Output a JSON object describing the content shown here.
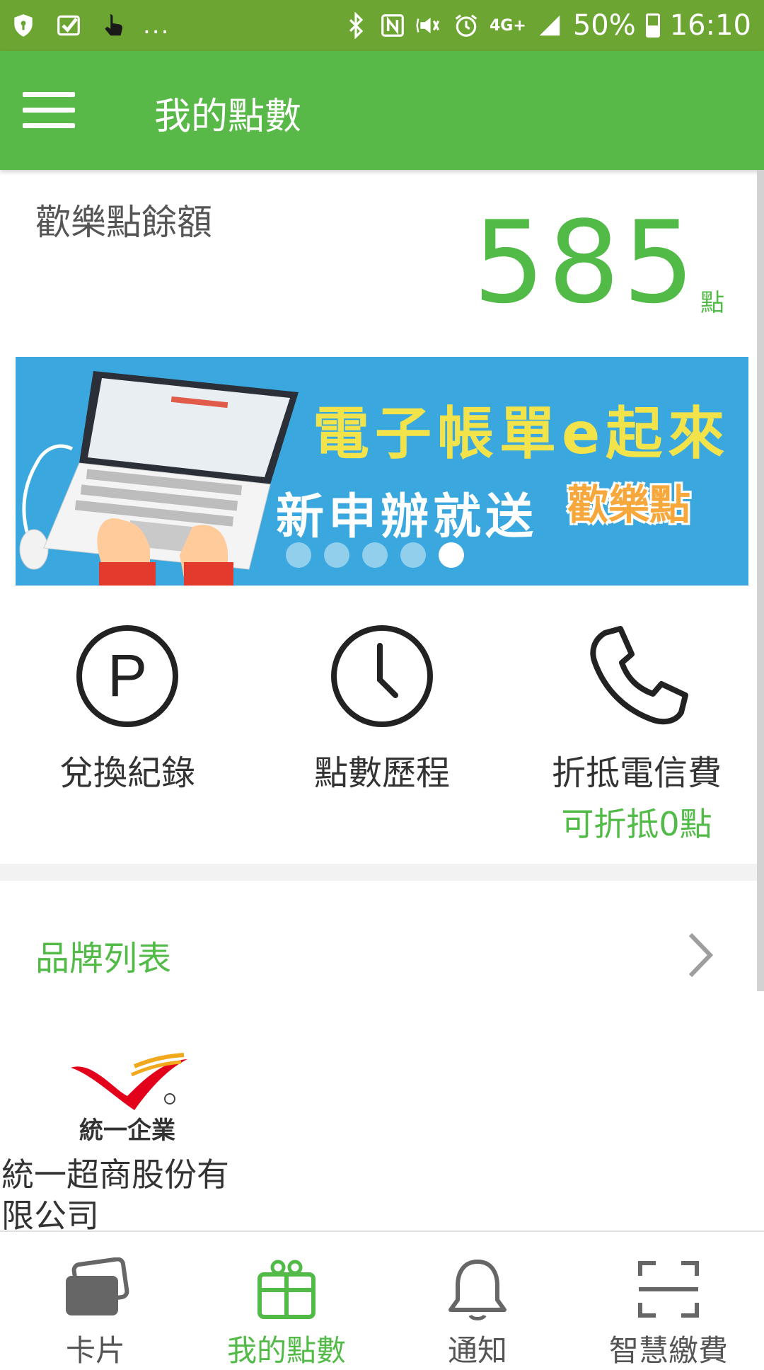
{
  "status_bar": {
    "left_icons": [
      "shield-icon",
      "check-icon",
      "touch-hand-icon"
    ],
    "overflow": "...",
    "right_icons": [
      "bluetooth-icon",
      "nfc-icon",
      "vibrate-icon",
      "alarm-icon",
      "network-4g-icon",
      "signal-icon"
    ],
    "network": "4G+",
    "battery": "50%",
    "time": "16:10"
  },
  "app_bar": {
    "title": "我的點數"
  },
  "balance": {
    "label": "歡樂點餘額",
    "value": "585",
    "unit": "點"
  },
  "banner": {
    "line1": "電子帳單e起來",
    "line2": "新申辦就送",
    "brand": "歡樂點",
    "slide_count": 5,
    "active_slide": 5
  },
  "actions": [
    {
      "label": "兌換紀錄",
      "icon": "points-p-icon"
    },
    {
      "label": "點數歷程",
      "icon": "clock-icon"
    },
    {
      "label": "折抵電信費",
      "sub": "可折抵0點",
      "icon": "phone-icon"
    }
  ],
  "brand_list": {
    "title": "品牌列表",
    "items": [
      {
        "name": "統一超商股份有限公司",
        "logo_text": "統一企業"
      }
    ]
  },
  "bottom_nav": [
    {
      "label": "卡片",
      "icon": "card-icon",
      "active": false
    },
    {
      "label": "我的點數",
      "icon": "gift-icon",
      "active": true
    },
    {
      "label": "通知",
      "icon": "bell-icon",
      "active": false
    },
    {
      "label": "智慧繳費",
      "icon": "scan-icon",
      "active": false
    }
  ],
  "colors": {
    "status_bar": "#6da532",
    "app_bar": "#58b948",
    "accent": "#52bb47",
    "banner_bg": "#3aa8df"
  }
}
